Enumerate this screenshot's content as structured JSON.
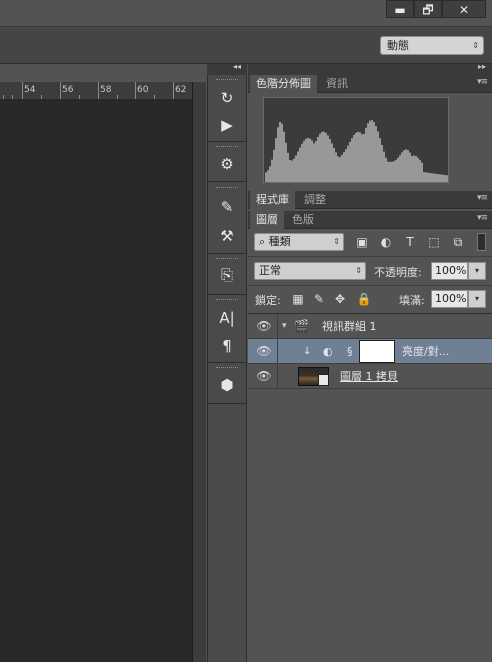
{
  "window": {
    "minimize_icon": "minimize-icon",
    "restore_icon": "restore-icon",
    "close_icon": "close-icon",
    "minimize_glyph": "▬",
    "restore_glyph": "🗗",
    "close_glyph": "✕"
  },
  "options_bar": {
    "workspace_label": "動態",
    "workspace_arrow": "⇕"
  },
  "ruler": {
    "ticks": [
      "54",
      "56",
      "58",
      "60",
      "62"
    ]
  },
  "toolstrip": {
    "collapse_glyph": "◂◂",
    "tools": [
      {
        "name": "history-icon",
        "glyph": "↻"
      },
      {
        "name": "actions-play-icon",
        "glyph": "▶"
      },
      {
        "name": "properties-icon",
        "glyph": "⚙"
      },
      {
        "name": "brush-icon",
        "glyph": "✎"
      },
      {
        "name": "brush-presets-icon",
        "glyph": "⚒"
      },
      {
        "name": "clone-source-icon",
        "glyph": "⎘"
      },
      {
        "name": "character-icon",
        "glyph": "A|"
      },
      {
        "name": "paragraph-icon",
        "glyph": "¶"
      },
      {
        "name": "3d-icon",
        "glyph": "⬢"
      }
    ]
  },
  "panels": {
    "expand_glyph": "▸▸",
    "menu_glyph": "▾≡",
    "histogram_tabs": [
      "色階分佈圖",
      "資訊"
    ],
    "library_tabs": [
      "程式庫",
      "調整"
    ],
    "layers_tabs": [
      "圖層",
      "色版"
    ]
  },
  "layers": {
    "filter_label": "種類",
    "filter_glyph": "⌕",
    "filter_arrow": "⇕",
    "filter_icons": [
      {
        "name": "pixel-filter-icon",
        "glyph": "▣"
      },
      {
        "name": "adjustment-filter-icon",
        "glyph": "◐"
      },
      {
        "name": "type-filter-icon",
        "glyph": "T"
      },
      {
        "name": "shape-filter-icon",
        "glyph": "⬚"
      },
      {
        "name": "smart-object-filter-icon",
        "glyph": "⧉"
      }
    ],
    "blend_mode": "正常",
    "blend_arrow": "⇕",
    "opacity_label": "不透明度:",
    "opacity_value": "100%",
    "lock_label": "鎖定:",
    "lock_icons": [
      {
        "name": "lock-transparent-icon",
        "glyph": "▦"
      },
      {
        "name": "lock-paint-icon",
        "glyph": "✎"
      },
      {
        "name": "lock-position-icon",
        "glyph": "✥"
      },
      {
        "name": "lock-all-icon",
        "glyph": "🔒"
      }
    ],
    "fill_label": "填滿:",
    "fill_value": "100%",
    "spin_glyph": "▾",
    "eye_glyph": "👁",
    "folder_toggle_glyph": "▾",
    "folder_glyph": "🎬",
    "clip_glyph": "↓",
    "adjust_glyph": "◐",
    "link_glyph": "§",
    "items": [
      {
        "name": "視訊群組 1",
        "type": "group"
      },
      {
        "name": "亮度/對...",
        "type": "adjustment"
      },
      {
        "name": "圖層 1 拷貝",
        "type": "video"
      }
    ]
  }
}
